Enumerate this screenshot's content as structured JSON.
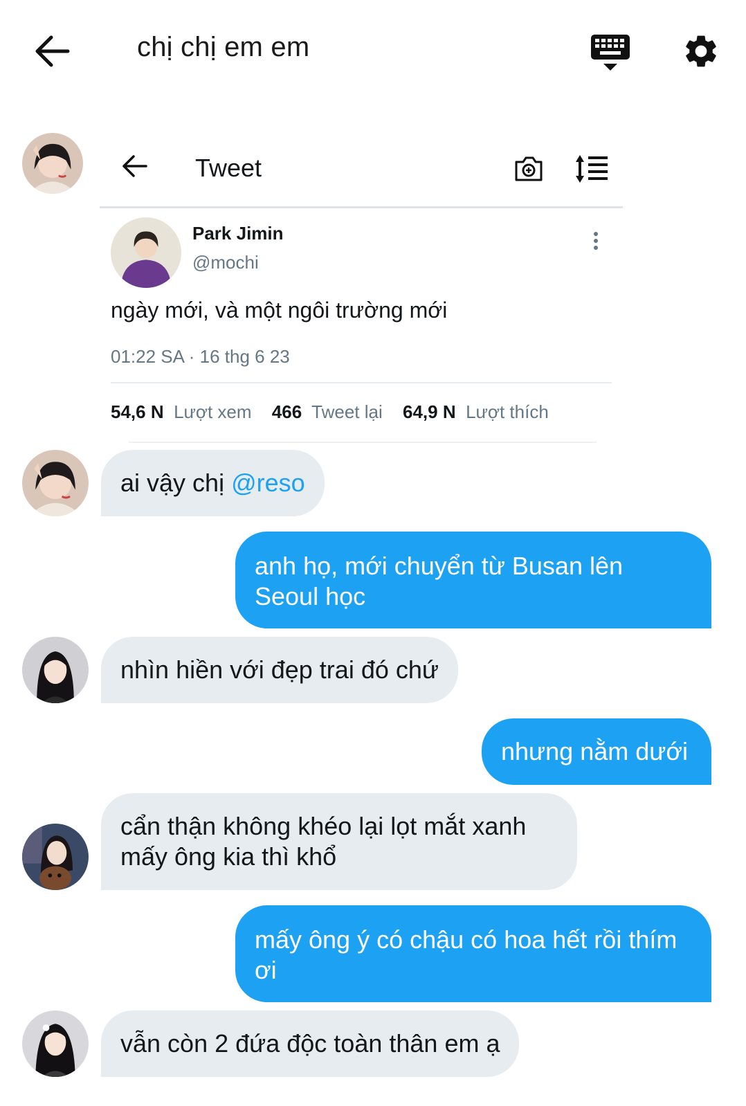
{
  "header": {
    "title": "chị chị em em"
  },
  "tweet_card": {
    "title": "Tweet",
    "author_name": "Park Jimin",
    "author_handle": "@mochi",
    "text": "ngày mới, và một ngôi trường mới",
    "timestamp": "01:22 SA · 16 thg 6 23",
    "stats": [
      {
        "value": "54,6 N",
        "label": "Lượt xem"
      },
      {
        "value": "466",
        "label": "Tweet lại"
      },
      {
        "value": "64,9 N",
        "label": "Lượt thích"
      }
    ]
  },
  "messages": [
    {
      "text": "ai vậy chị ",
      "mention": "@reso"
    },
    {
      "text": "anh họ, mới chuyển từ Busan lên Seoul học"
    },
    {
      "text": "nhìn hiền với đẹp trai đó chứ"
    },
    {
      "text": "nhưng nằm dưới"
    },
    {
      "text": "cẩn thận không khéo lại lọt mắt xanh mấy ông kia thì khổ"
    },
    {
      "text": "mấy ông ý có chậu có hoa hết rồi thím ơi"
    },
    {
      "text": "vẫn còn 2 đứa độc toàn thân em ạ"
    }
  ],
  "colors": {
    "accent": "#1da1f2",
    "incoming_bubble": "#e6ecf0",
    "secondary_text": "#657786"
  }
}
